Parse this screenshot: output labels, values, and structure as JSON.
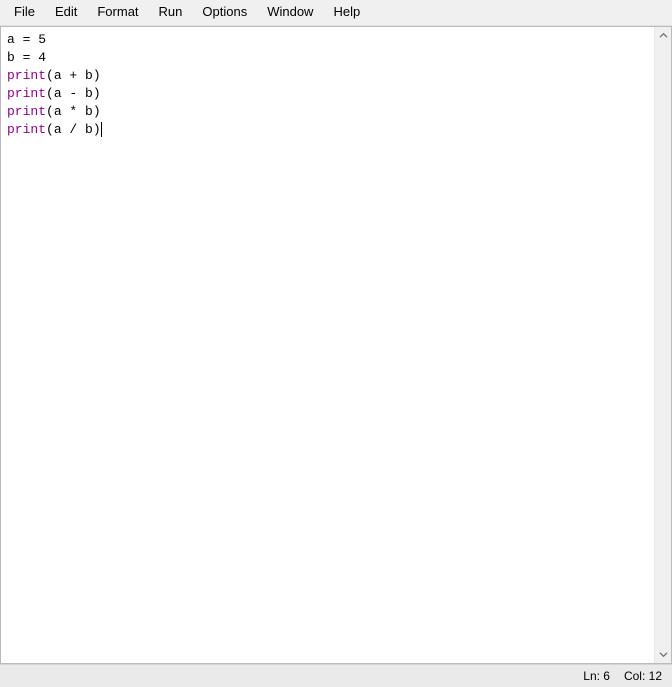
{
  "menu": {
    "items": [
      "File",
      "Edit",
      "Format",
      "Run",
      "Options",
      "Window",
      "Help"
    ]
  },
  "code": {
    "lines": [
      {
        "tokens": [
          {
            "t": "a = 5",
            "cls": ""
          }
        ]
      },
      {
        "tokens": [
          {
            "t": "b = 4",
            "cls": ""
          }
        ]
      },
      {
        "tokens": [
          {
            "t": "print",
            "cls": "kw"
          },
          {
            "t": "(a + b)",
            "cls": ""
          }
        ]
      },
      {
        "tokens": [
          {
            "t": "print",
            "cls": "kw"
          },
          {
            "t": "(a - b)",
            "cls": ""
          }
        ]
      },
      {
        "tokens": [
          {
            "t": "print",
            "cls": "kw"
          },
          {
            "t": "(a * b)",
            "cls": ""
          }
        ]
      },
      {
        "tokens": [
          {
            "t": "print",
            "cls": "kw"
          },
          {
            "t": "(a / b)",
            "cls": ""
          }
        ],
        "cursor": true
      }
    ]
  },
  "status": {
    "ln_label": "Ln: 6",
    "col_label": "Col: 12"
  },
  "scroll": {
    "up_glyph": "⌃",
    "down_glyph": "⌄"
  }
}
